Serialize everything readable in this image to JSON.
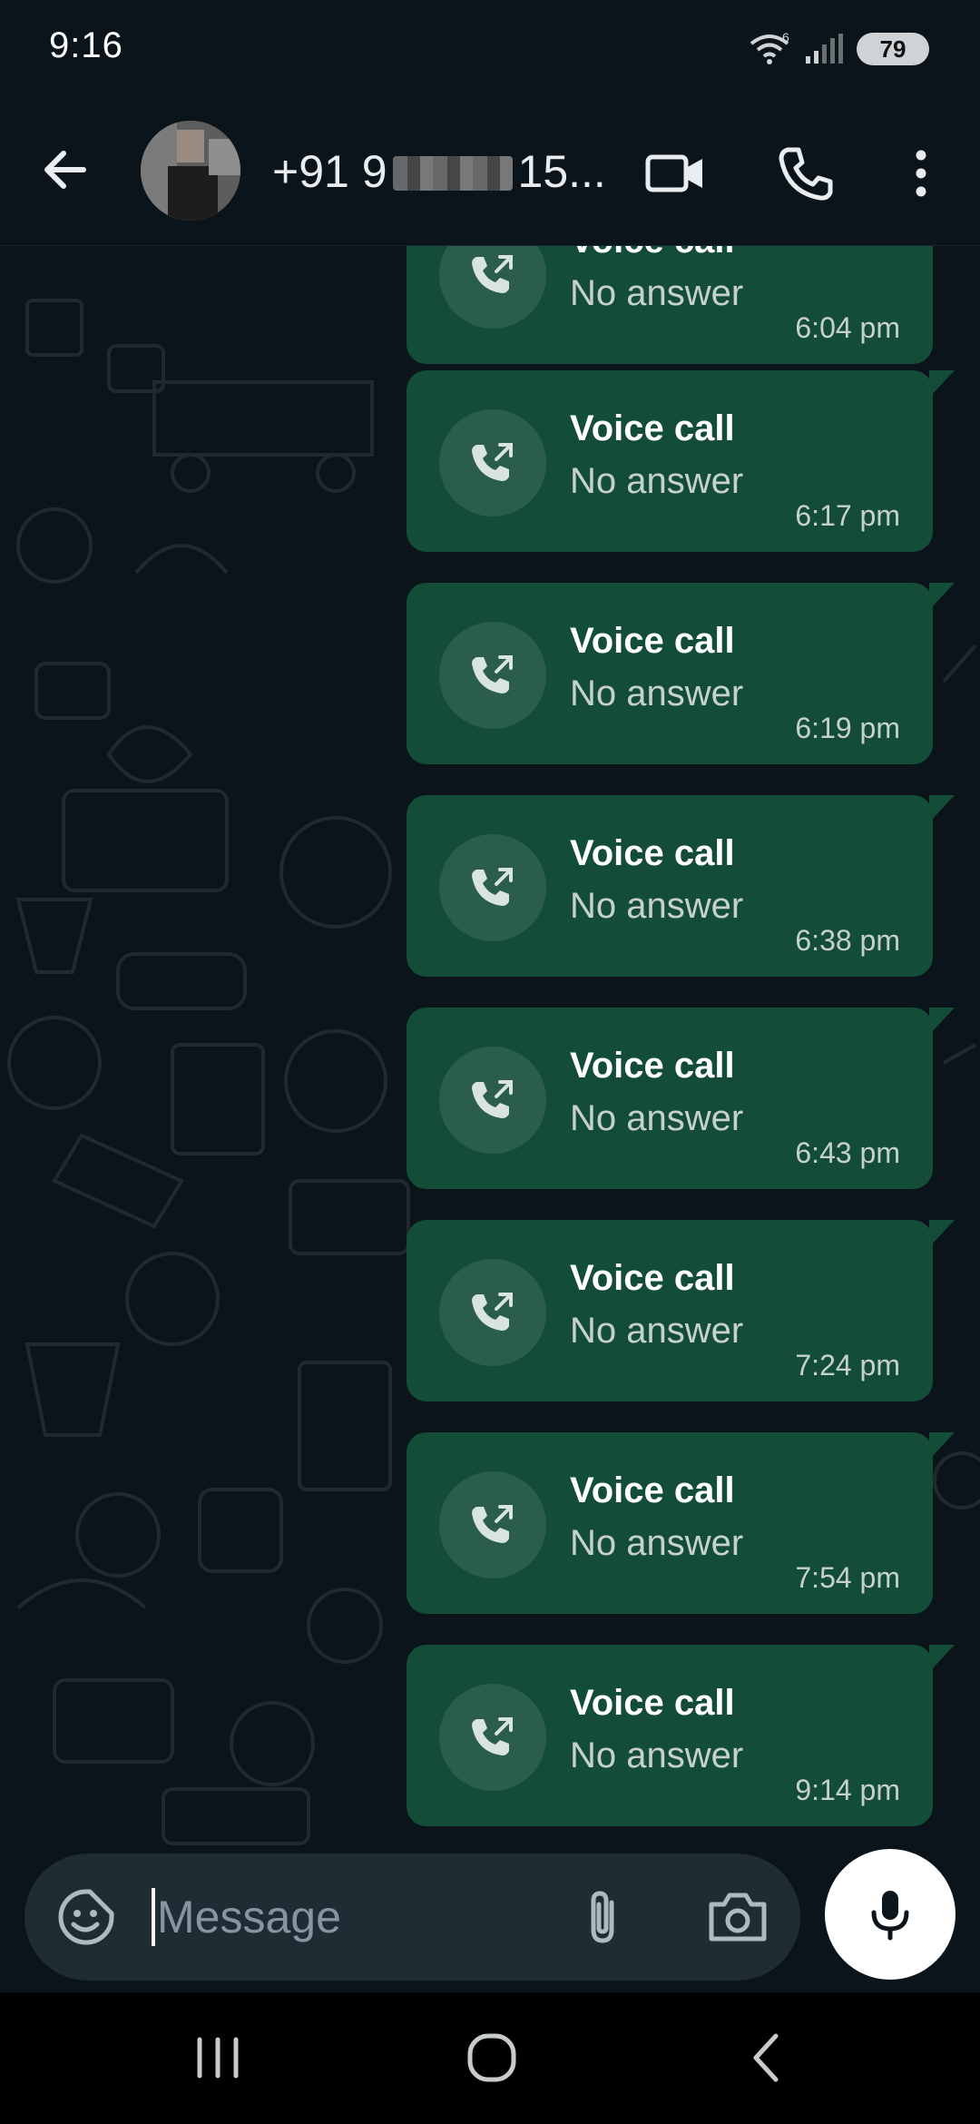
{
  "status_bar": {
    "time": "9:16",
    "battery_level": "79",
    "network_badge": "6",
    "icons": [
      "wifi-icon",
      "signal-icon",
      "battery-icon"
    ]
  },
  "header": {
    "contact_name_prefix": "+91 9",
    "contact_name_suffix": "15...",
    "icons": [
      "back-arrow-icon",
      "avatar",
      "video-call-icon",
      "phone-icon",
      "more-vertical-icon"
    ]
  },
  "messages": [
    {
      "title": "Voice call",
      "status": "No answer",
      "time": "6:04 pm"
    },
    {
      "title": "Voice call",
      "status": "No answer",
      "time": "6:17 pm"
    },
    {
      "title": "Voice call",
      "status": "No answer",
      "time": "6:19 pm"
    },
    {
      "title": "Voice call",
      "status": "No answer",
      "time": "6:38 pm"
    },
    {
      "title": "Voice call",
      "status": "No answer",
      "time": "6:43 pm"
    },
    {
      "title": "Voice call",
      "status": "No answer",
      "time": "7:24 pm"
    },
    {
      "title": "Voice call",
      "status": "No answer",
      "time": "7:54 pm"
    },
    {
      "title": "Voice call",
      "status": "No answer",
      "time": "9:14 pm"
    }
  ],
  "composer": {
    "placeholder": "Message",
    "icons": [
      "sticker-icon",
      "attach-icon",
      "camera-icon",
      "mic-icon"
    ]
  },
  "nav": {
    "icons": [
      "recents-icon",
      "home-icon",
      "nav-back-icon"
    ]
  },
  "colors": {
    "background": "#0b141a",
    "bubble": "#144d37",
    "input": "#1f2c34",
    "mic_button": "#ffffff"
  }
}
